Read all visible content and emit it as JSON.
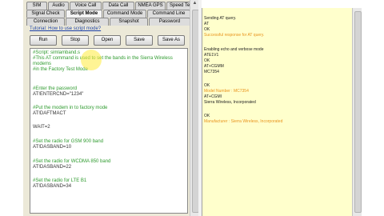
{
  "tabs_row1": [
    "SIM",
    "Audio",
    "Voice Call",
    "Data Call",
    "NMEA GPS",
    "Speed Test"
  ],
  "tabs_row2": [
    "Signal Check",
    "Script Mode",
    "Command Mode",
    "Command Line"
  ],
  "tabs_row3": [
    "Connection",
    "Diagnostics",
    "Snapshot",
    "Password"
  ],
  "tutorial_link": "Tutorial: How to use script mode?",
  "buttons": {
    "run": "Run",
    "stop": "Stop",
    "open": "Open",
    "save": "Save",
    "save_as": "Save As"
  },
  "script_lines": [
    "#Script: simlamband.s",
    "#This AT command is used to set the bands in the Sierra Wireless",
    "modems",
    "#in the Factory Test Mode",
    "#Enter the password",
    "AT!ENTERCND=\"1234\"",
    "#Put the modem in to factory mode",
    "AT!DAFTMACT",
    "WAIT=2",
    "#Set the radio for GSM 900 band",
    "AT!DASBAND=10",
    "#Set the radio for WCDMA 850 band",
    "AT!DASBAND=22",
    "#Set the radio for LTE B1",
    "AT!DASBAND=34"
  ],
  "output_lines": [
    "Sending AT query.",
    "AT",
    "OK",
    "Successful response for AT query.",
    "Enabling echo and verbose mode",
    "ATE1V1",
    "OK",
    "AT+CGMM",
    "MC7354",
    "OK",
    "Model Number : MC7354",
    "AT+CGMI",
    "Sierra Wireless, Incorporated",
    "OK",
    "Manufacturer : Sierra Wireless, Incorporated"
  ],
  "colors": {
    "comment": "#2f9b2f",
    "highlight": "#e8931c",
    "output_bg": "#ffffcc"
  }
}
